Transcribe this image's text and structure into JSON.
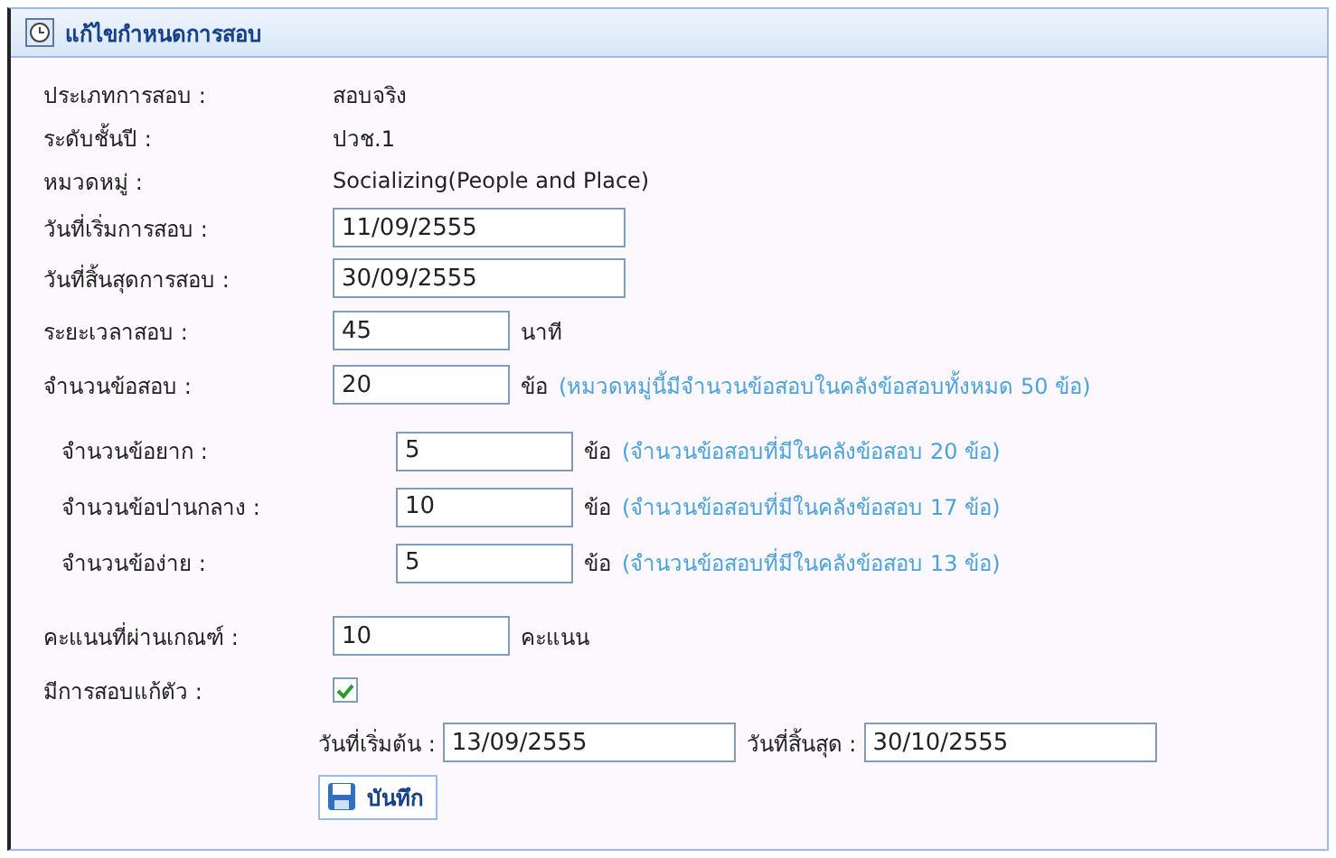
{
  "panel": {
    "title": "แก้ไขกำหนดการสอบ"
  },
  "fields": [
    {
      "kind": "text",
      "label": "ประเภทการสอบ :",
      "value": "สอบจริง"
    },
    {
      "kind": "text",
      "label": "ระดับชั้นปี :",
      "value": "ปวช.1"
    },
    {
      "kind": "text",
      "label": "หมวดหมู่ :",
      "value": "Socializing(People and Place)"
    },
    {
      "kind": "date",
      "label": "วันที่เริ่มการสอบ :",
      "value": "11/09/2555"
    },
    {
      "kind": "date",
      "label": "วันที่สิ้นสุดการสอบ :",
      "value": "30/09/2555"
    },
    {
      "kind": "number",
      "label": "ระยะเวลาสอบ :",
      "value": "45",
      "unit": "นาที"
    },
    {
      "kind": "number",
      "label": "จำนวนข้อสอบ :",
      "value": "20",
      "unit": "ข้อ",
      "note": "(หมวดหมู่นี้มีจำนวนข้อสอบในคลังข้อสอบทั้งหมด 50 ข้อ)",
      "children": [
        {
          "label": "จำนวนข้อยาก :",
          "value": "5",
          "unit": "ข้อ",
          "note": "(จำนวนข้อสอบที่มีในคลังข้อสอบ 20 ข้อ)"
        },
        {
          "label": "จำนวนข้อปานกลาง :",
          "value": "10",
          "unit": "ข้อ",
          "note": "(จำนวนข้อสอบที่มีในคลังข้อสอบ 17 ข้อ)"
        },
        {
          "label": "จำนวนข้อง่าย :",
          "value": "5",
          "unit": "ข้อ",
          "note": "(จำนวนข้อสอบที่มีในคลังข้อสอบ 13 ข้อ)"
        }
      ]
    },
    {
      "kind": "number",
      "label": "คะแนนที่ผ่านเกณฑ์ :",
      "value": "10",
      "unit": "คะแนน"
    },
    {
      "kind": "checkbox",
      "label": "มีการสอบแก้ตัว :",
      "checked": true
    }
  ],
  "retake_dates": [
    {
      "label": "วันที่เริ่มต้น :",
      "value": "13/09/2555"
    },
    {
      "label": "วันที่สิ้นสุด :",
      "value": "30/10/2555"
    }
  ],
  "save_button": {
    "label": "บันทึก"
  }
}
